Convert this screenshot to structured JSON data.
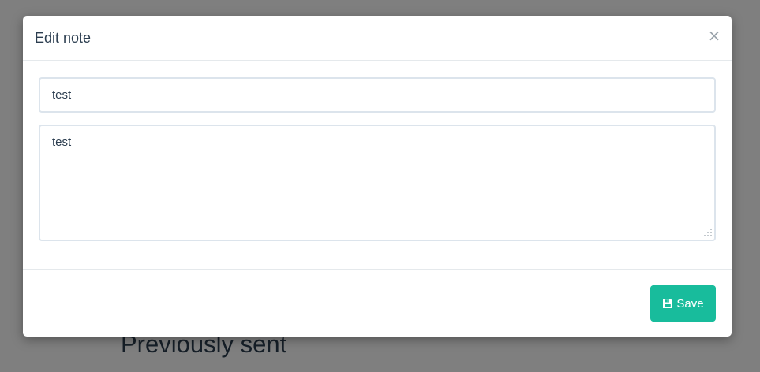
{
  "background": {
    "heading": "Previously sent"
  },
  "modal": {
    "title": "Edit note",
    "close_symbol": "×",
    "title_input_value": "test",
    "body_textarea_value": "test",
    "save_label": "Save",
    "save_icon": "floppy-disk-icon"
  },
  "colors": {
    "primary": "#18bc9c",
    "text": "#2c3e50",
    "input_border": "#dce4ec"
  }
}
